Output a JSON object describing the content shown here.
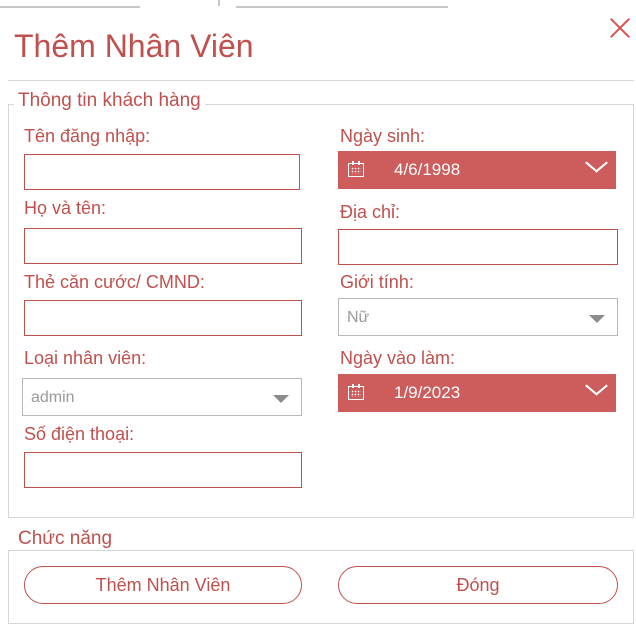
{
  "window": {
    "title": "Thêm Nhân Viên",
    "close_icon": "close-icon"
  },
  "info_group": {
    "legend": "Thông tin khách hàng",
    "username": {
      "label": "Tên đăng nhập:",
      "value": ""
    },
    "fullname": {
      "label": "Họ và tên:",
      "value": ""
    },
    "id_card": {
      "label": "Thẻ căn cước/ CMND:",
      "value": ""
    },
    "employee_type": {
      "label": "Loại nhân viên:",
      "selected": "admin"
    },
    "phone": {
      "label": "Số điện thoại:",
      "value": ""
    },
    "birthdate": {
      "label": "Ngày sinh:",
      "value": "4/6/1998"
    },
    "address": {
      "label": "Địa chỉ:",
      "value": ""
    },
    "gender": {
      "label": "Giới tính:",
      "selected": "Nữ"
    },
    "start_date": {
      "label": "Ngày vào làm:",
      "value": "1/9/2023"
    }
  },
  "func_group": {
    "legend": "Chức năng",
    "add_label": "Thêm Nhân Viên",
    "close_label": "Đóng"
  },
  "colors": {
    "accent": "#c0504d",
    "datepicker": "#cd5c5c",
    "border": "#d6d6d6"
  }
}
